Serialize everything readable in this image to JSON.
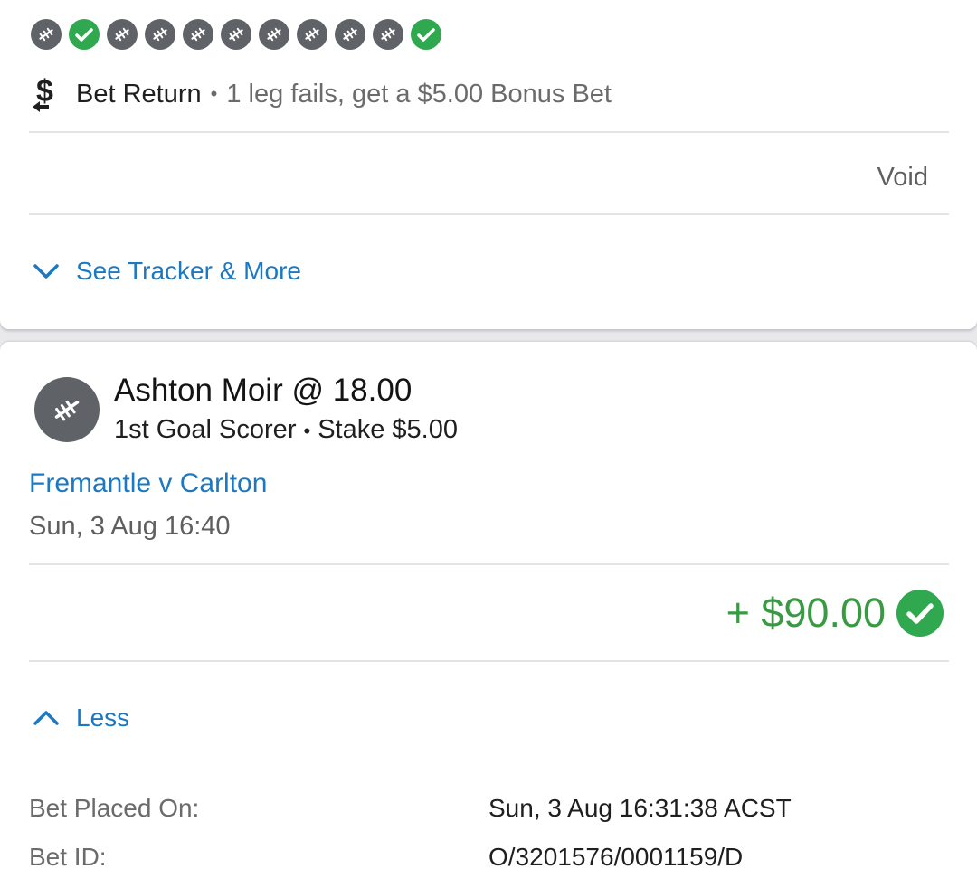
{
  "previous_bet": {
    "legs": [
      {
        "status": "pending",
        "icon": "football-icon"
      },
      {
        "status": "won",
        "icon": "check-icon"
      },
      {
        "status": "pending",
        "icon": "football-icon"
      },
      {
        "status": "pending",
        "icon": "football-icon"
      },
      {
        "status": "pending",
        "icon": "football-icon"
      },
      {
        "status": "pending",
        "icon": "football-icon"
      },
      {
        "status": "pending",
        "icon": "football-icon"
      },
      {
        "status": "pending",
        "icon": "football-icon"
      },
      {
        "status": "pending",
        "icon": "football-icon"
      },
      {
        "status": "pending",
        "icon": "football-icon"
      },
      {
        "status": "won",
        "icon": "check-icon"
      }
    ],
    "bet_return_title": "Bet Return",
    "separator": "•",
    "bet_return_desc": "1 leg fails, get a $5.00 Bonus Bet",
    "result": "Void",
    "toggle_label": "See Tracker & More"
  },
  "current_bet": {
    "selection": "Ashton Moir @ 18.00",
    "market": "1st Goal Scorer",
    "separator": "•",
    "stake": "Stake $5.00",
    "event": "Fremantle v Carlton",
    "event_time": "Sun, 3 Aug 16:40",
    "payout": "+ $90.00",
    "toggle_label": "Less",
    "details": [
      {
        "label": "Bet Placed On:",
        "value": "Sun, 3 Aug 16:31:38 ACST"
      },
      {
        "label": "Bet ID:",
        "value": "O/3201576/0001159/D"
      }
    ]
  },
  "colors": {
    "accent_blue": "#1b78c2",
    "won_green": "#2fa84f",
    "payout_green": "#3a9a43",
    "pending_grey": "#5f6368"
  }
}
